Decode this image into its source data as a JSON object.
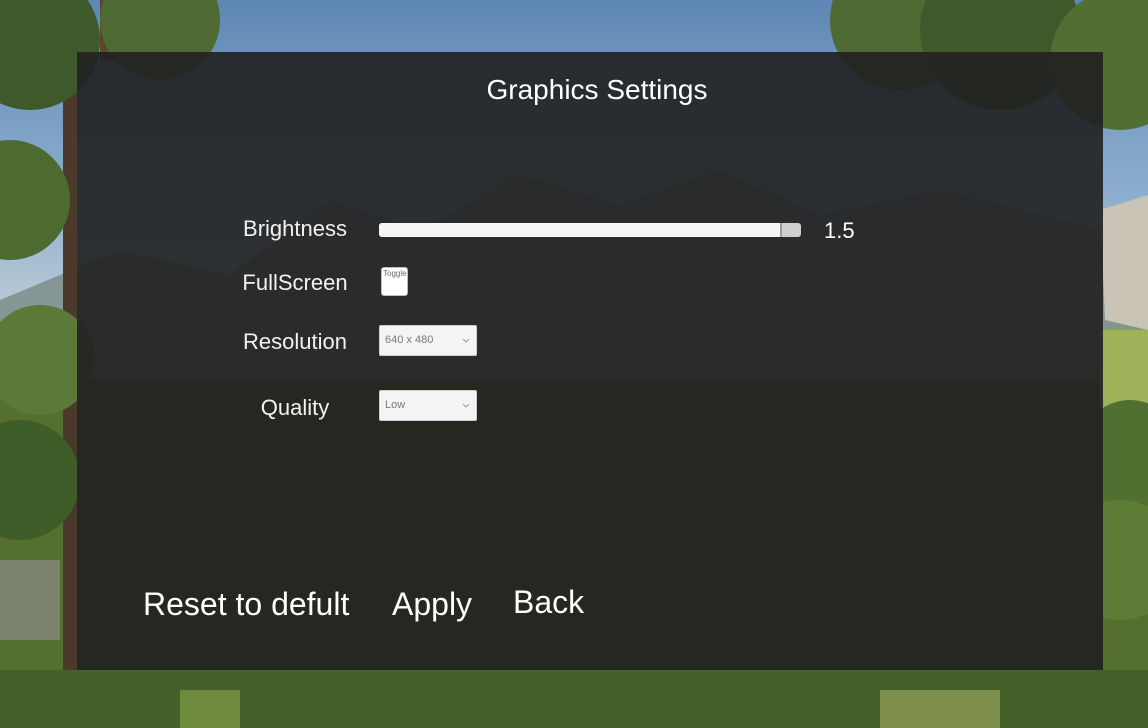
{
  "window": {
    "title": "Graphics Settings"
  },
  "settings": {
    "brightness": {
      "label": "Brightness",
      "value_text": "1.5",
      "fill_fraction": 0.95
    },
    "fullscreen": {
      "label": "FullScreen",
      "toggle_text": "Toggle"
    },
    "resolution": {
      "label": "Resolution",
      "selected": "640 x 480"
    },
    "quality": {
      "label": "Quality",
      "selected": "Low"
    }
  },
  "buttons": {
    "reset_label": "Reset to defult",
    "apply_label": "Apply",
    "back_label": "Back"
  },
  "icons": {
    "dropdown_arrow": "chevron-down-icon"
  },
  "colors": {
    "panel": "#202020",
    "text": "#ffffff",
    "slider_track": "#cfcfcf",
    "slider_fill": "#f5f5f5"
  }
}
